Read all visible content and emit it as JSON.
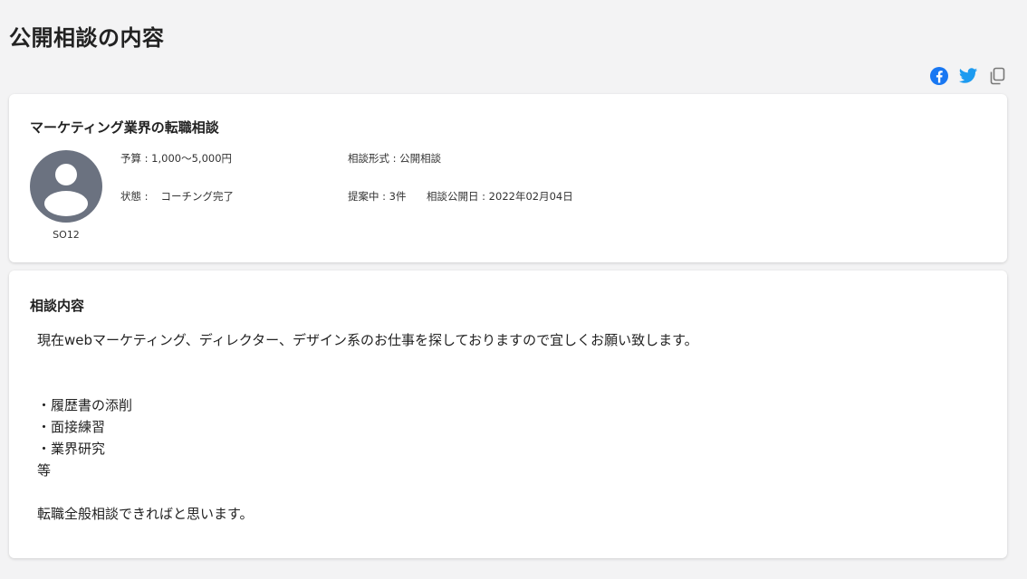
{
  "page": {
    "title": "公開相談の内容"
  },
  "share": {
    "facebook_icon": "facebook-icon",
    "twitter_icon": "twitter-icon",
    "copy_icon": "copy-icon",
    "facebook_color": "#1877f2",
    "twitter_color": "#1d9bf0",
    "copy_color": "#777777"
  },
  "consultation": {
    "title": "マーケティング業界の転職相談",
    "user_name": "SO12",
    "budget": "予算 : 1,000～5,000円",
    "format": "相談形式 : 公開相談",
    "status_label": "状態 :",
    "status_value": "コーチング完了",
    "proposals": "提案中 : 3件",
    "published": "相談公開日 : 2022年02月04日"
  },
  "detail": {
    "heading": "相談内容",
    "lines": [
      "現在webマーケティング、ディレクター、デザイン系のお仕事を探しておりますので宜しくお願い致します。",
      "",
      "",
      "・履歴書の添削",
      "・面接練習",
      "・業界研究",
      "等",
      "",
      "転職全般相談できればと思います。"
    ]
  }
}
